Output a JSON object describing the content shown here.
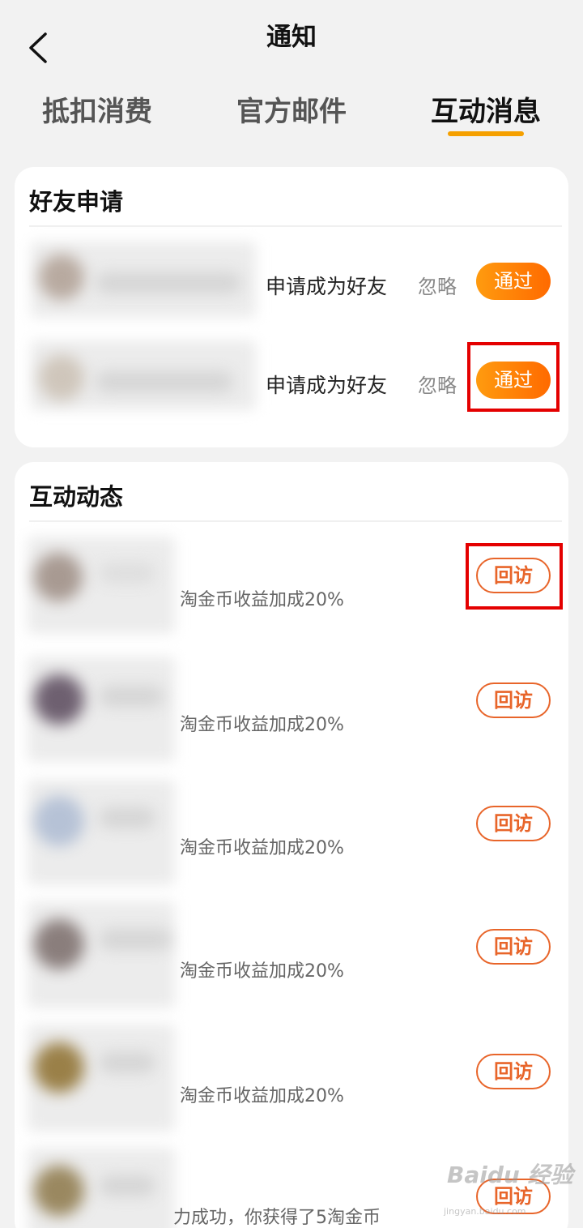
{
  "header": {
    "title": "通知"
  },
  "tabs": [
    {
      "label": "抵扣消费"
    },
    {
      "label": "官方邮件"
    },
    {
      "label": "互动消息"
    }
  ],
  "friend_requests": {
    "title": "好友申请",
    "items": [
      {
        "text": "申请成为好友",
        "ignore_label": "忽略",
        "accept_label": "通过"
      },
      {
        "text": "申请成为好友",
        "ignore_label": "忽略",
        "accept_label": "通过"
      }
    ]
  },
  "activity": {
    "title": "互动动态",
    "items": [
      {
        "text": "淘金币收益加成20%",
        "visit_label": "回访"
      },
      {
        "text": "淘金币收益加成20%",
        "visit_label": "回访"
      },
      {
        "text": "淘金币收益加成20%",
        "visit_label": "回访"
      },
      {
        "text": "淘金币收益加成20%",
        "visit_label": "回访"
      },
      {
        "text": "淘金币收益加成20%",
        "visit_label": "回访"
      },
      {
        "text": "力成功，你获得了5淘金币",
        "visit_label": "回访"
      }
    ]
  },
  "watermark": {
    "logo": "Baidu 经验",
    "sub": "jingyan.baidu.com"
  },
  "colors": {
    "accent": "#f5a000",
    "button_gradient_start": "#ff9b0f",
    "button_gradient_end": "#ff6a00",
    "visit_border": "#e8652a",
    "highlight": "#e40000"
  }
}
